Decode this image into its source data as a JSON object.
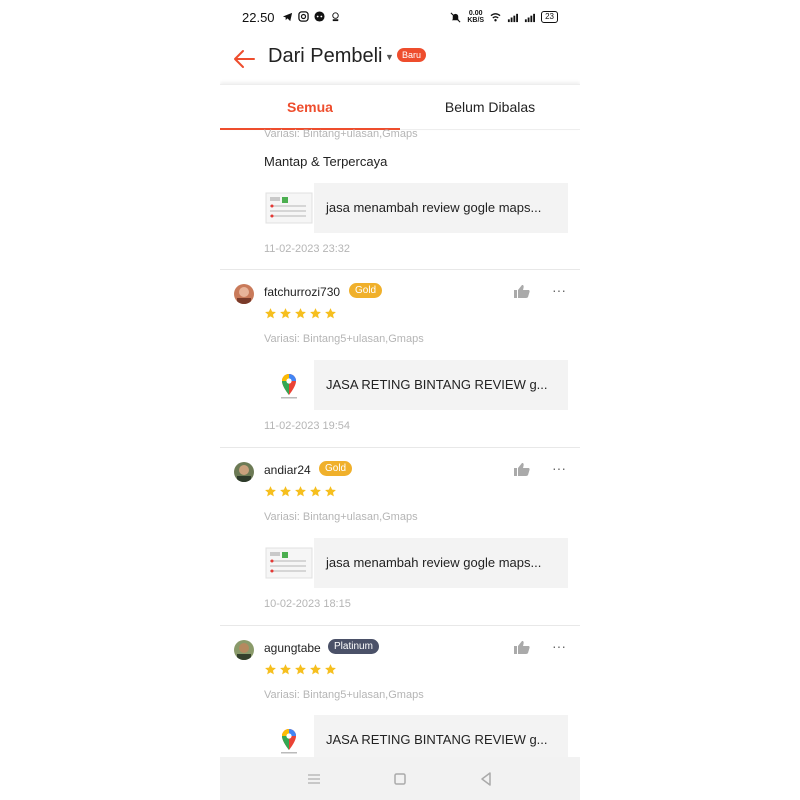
{
  "status_bar": {
    "time": "22.50",
    "speed_value": "0.00",
    "speed_unit": "KB/S",
    "battery": "23"
  },
  "header": {
    "title": "Dari Pembeli",
    "badge": "Baru",
    "accent_color": "#ee4d2d"
  },
  "tabs": [
    {
      "label": "Semua",
      "active": true
    },
    {
      "label": "Belum Dibalas",
      "active": false
    }
  ],
  "reviews": [
    {
      "variation": "Variasi: Bintang+ulasan,Gmaps",
      "comment": "Mantap & Terpercaya",
      "product": "jasa menambah review gogle maps...",
      "thumb_icon": "screenshot-thumbnail-icon",
      "date": "11-02-2023 23:32"
    },
    {
      "username": "fatchurrozi730",
      "tier": "Gold",
      "rating": 5,
      "variation": "Variasi: Bintang5+ulasan,Gmaps",
      "product": "JASA RETING BINTANG REVIEW g...",
      "thumb_icon": "google-maps-icon",
      "date": "11-02-2023 19:54"
    },
    {
      "username": "andiar24",
      "tier": "Gold",
      "rating": 5,
      "variation": "Variasi: Bintang+ulasan,Gmaps",
      "product": "jasa menambah review gogle maps...",
      "thumb_icon": "screenshot-thumbnail-icon",
      "date": "10-02-2023 18:15"
    },
    {
      "username": "agungtabe",
      "tier": "Platinum",
      "rating": 5,
      "variation": "Variasi: Bintang5+ulasan,Gmaps",
      "product": "JASA RETING BINTANG REVIEW g...",
      "thumb_icon": "google-maps-icon"
    }
  ],
  "colors": {
    "gold": "#f0b02b",
    "platinum": "#4b5168",
    "star": "#f6bf1e"
  }
}
